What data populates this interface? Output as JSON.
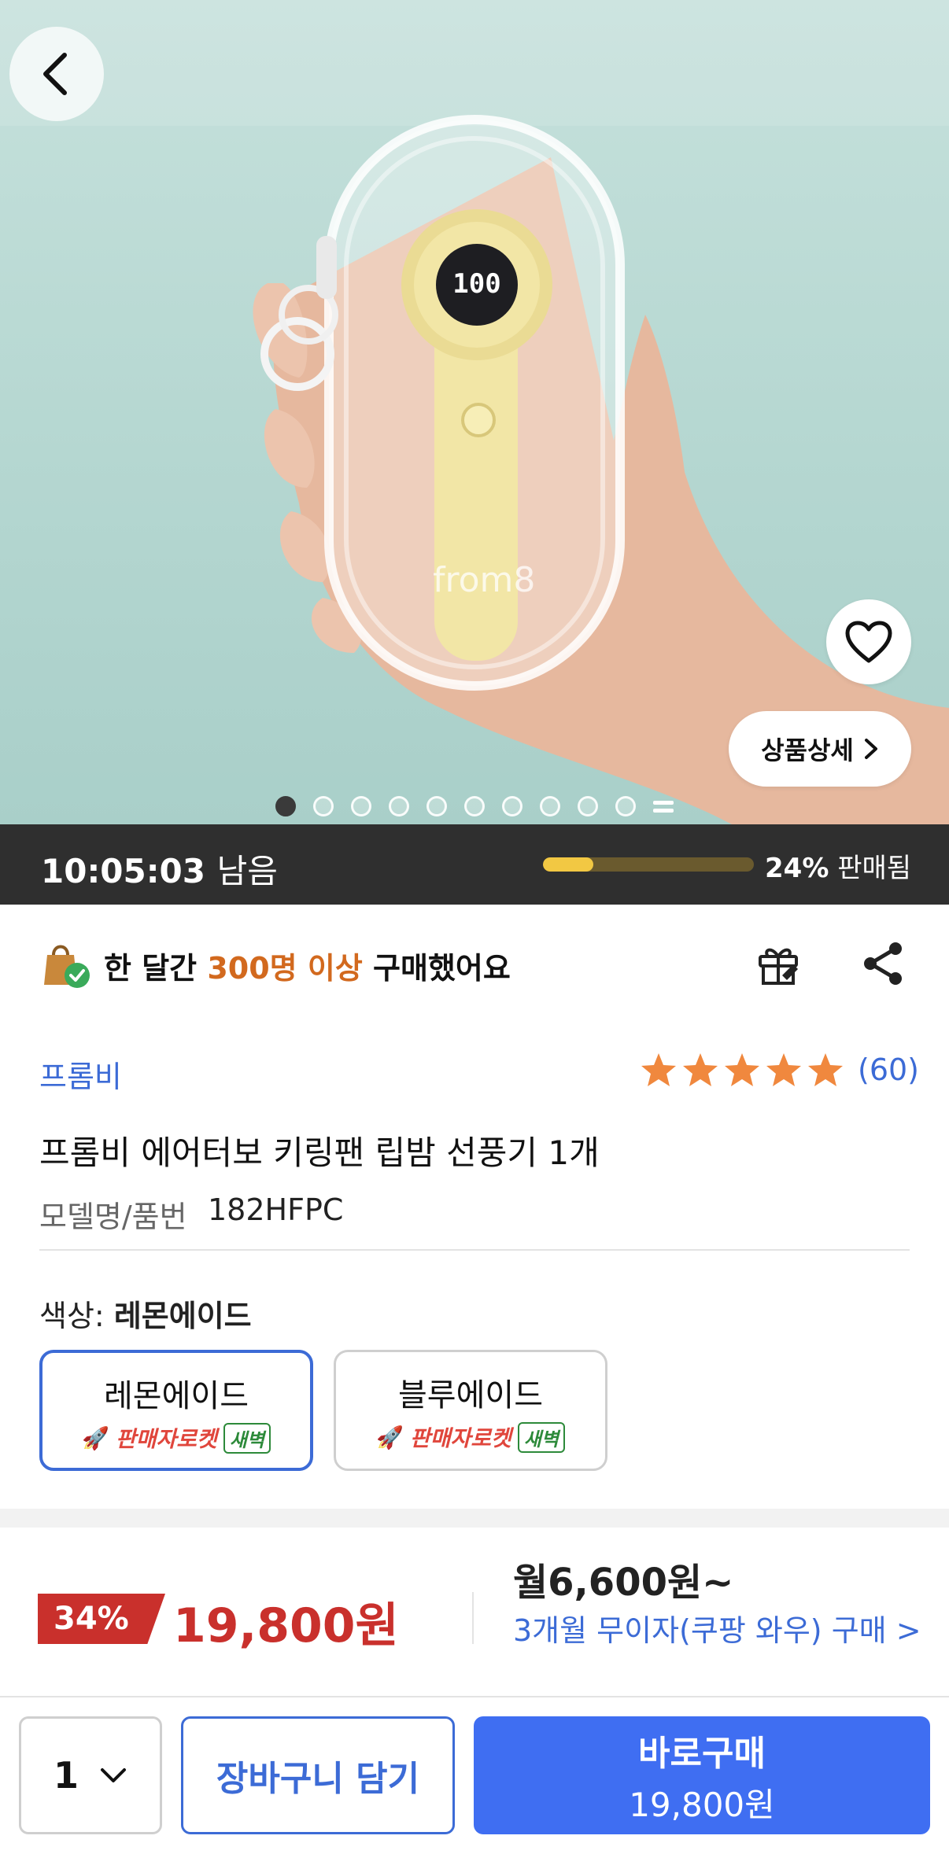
{
  "hero": {
    "detail_label": "상품상세",
    "image_count": 10,
    "active_image": 1
  },
  "timer": {
    "time": "10:05:03",
    "remain_label": "남음",
    "sold_percent": "24%",
    "sold_label": "판매됨",
    "sold_fraction": 0.24
  },
  "purchase": {
    "prefix": "한 달간",
    "highlight": "300명 이상",
    "suffix": "구매했어요"
  },
  "product": {
    "brand": "프롬비",
    "rating": 5,
    "review_count": "(60)",
    "title": "프롬비 에어터보 키링팬 립밤 선풍기 1개",
    "model_label": "모델명/품번",
    "model_value": "182HFPC"
  },
  "color": {
    "label": "색상:",
    "selected": "레몬에이드",
    "options": [
      {
        "name": "레몬에이드",
        "badge": "판매자로켓",
        "dawn": "새벽"
      },
      {
        "name": "블루에이드",
        "badge": "판매자로켓",
        "dawn": "새벽"
      }
    ]
  },
  "price": {
    "discount": "34%",
    "sale_price": "19,800원",
    "monthly": "월6,600원~",
    "installment": "3개월 무이자(쿠팡 와우) 구매 >"
  },
  "bottom": {
    "quantity": "1",
    "cart_label": "장바구니 담기",
    "buy_label": "바로구매",
    "buy_price": "19,800원"
  },
  "colors": {
    "accent": "#3f6ef2",
    "link": "#3c6bd6",
    "sale": "#c9302c",
    "highlight": "#d2691e",
    "star": "#f0883e",
    "progress": "#f2c843"
  }
}
